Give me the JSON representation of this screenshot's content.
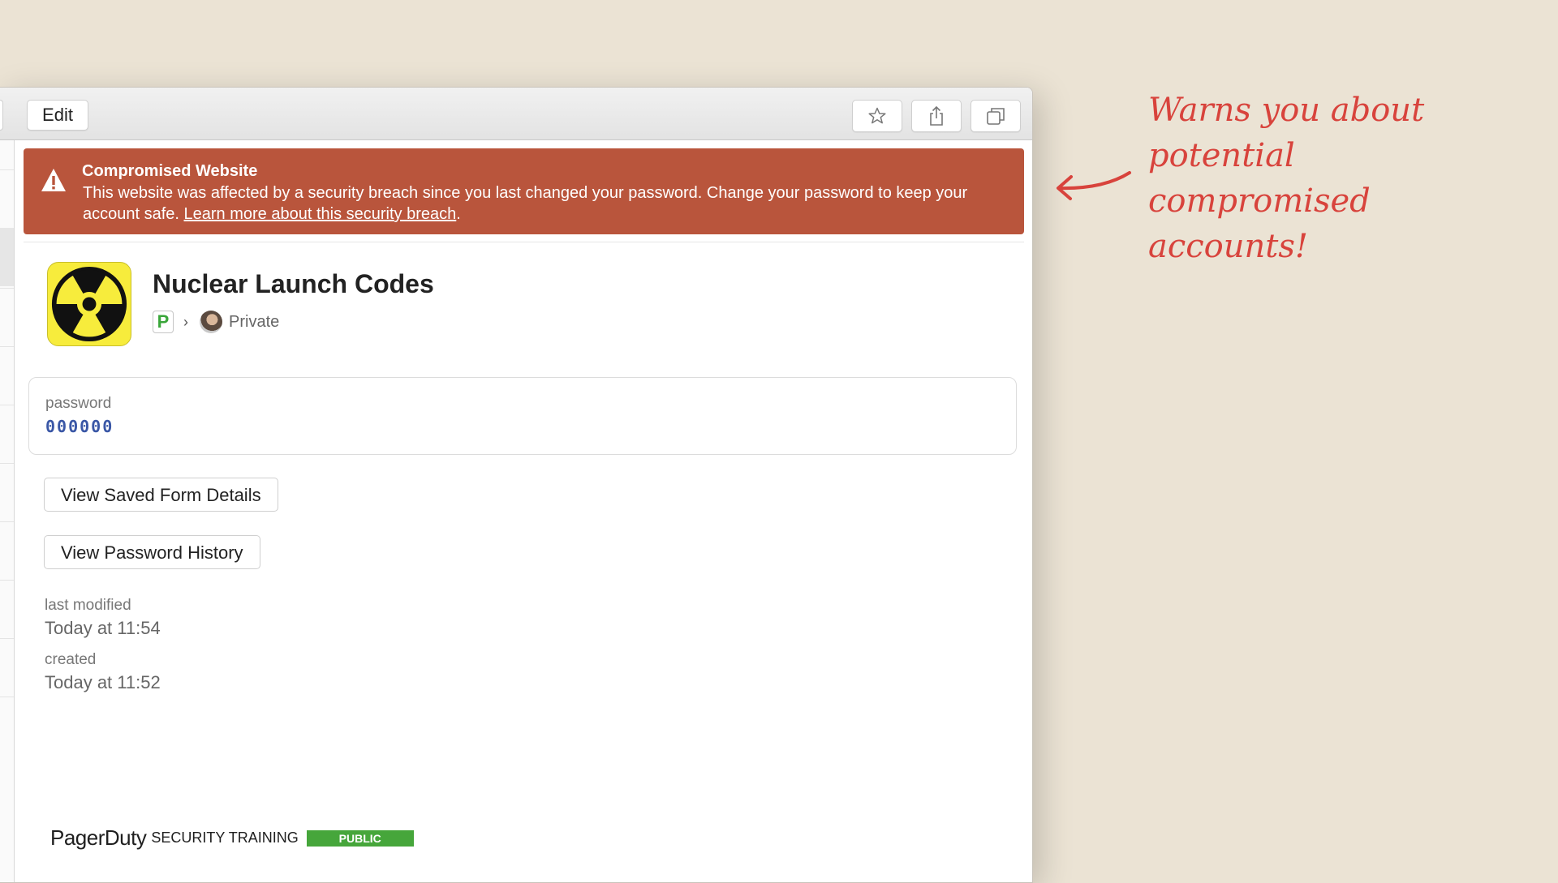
{
  "toolbar": {
    "edit_label": "Edit",
    "buttons": [
      {
        "icon": "star-icon"
      },
      {
        "icon": "share-icon"
      },
      {
        "icon": "copy-icon"
      }
    ]
  },
  "banner": {
    "icon": "warning-icon",
    "title": "Compromised Website",
    "text": "This website was affected by a security breach since you last changed your password. Change your password to keep your account safe. ",
    "link": "Learn more about this security breach",
    "suffix": ".",
    "color": "#b9553c"
  },
  "item": {
    "icon": "radiation-icon",
    "title": "Nuclear Launch Codes",
    "vault_badge": "P",
    "vault_name": "Private"
  },
  "password_field": {
    "label": "password",
    "value": "000000"
  },
  "actions": {
    "saved_form": "View Saved Form Details",
    "history": "View Password History"
  },
  "meta": {
    "modified_label": "last modified",
    "modified_value": "Today at 11:54",
    "created_label": "created",
    "created_value": "Today at 11:52"
  },
  "footer": {
    "brand": "PagerDuty",
    "subtitle": "SECURITY TRAINING",
    "badge": "PUBLIC",
    "badge_color": "#46a63b"
  },
  "annotation": {
    "line1": "Warns you about potential",
    "line2": "compromised accounts!",
    "color": "#d8433c"
  }
}
